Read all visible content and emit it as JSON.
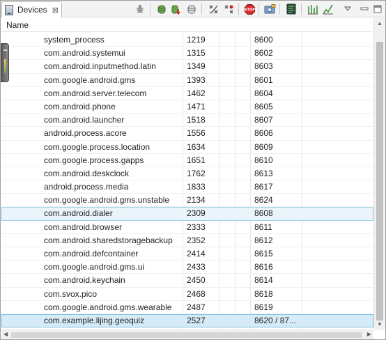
{
  "tab": {
    "label": "Devices",
    "close": "⊠"
  },
  "toolbar": {
    "icons": [
      "bug-icon",
      "heap-icon",
      "heap-dump-icon",
      "gc-icon",
      "threads-icon",
      "method-profiling-icon",
      "stop-process-icon",
      "screen-capture-icon",
      "systrace-icon",
      "allocation-tracker-icon",
      "network-icon",
      "view-menu-icon"
    ]
  },
  "table": {
    "columns": {
      "name": "Name"
    },
    "rows": [
      {
        "name": "system_process",
        "pid": "1219",
        "port": "8600"
      },
      {
        "name": "com.android.systemui",
        "pid": "1315",
        "port": "8602"
      },
      {
        "name": "com.android.inputmethod.latin",
        "pid": "1349",
        "port": "8603"
      },
      {
        "name": "com.google.android.gms",
        "pid": "1393",
        "port": "8601"
      },
      {
        "name": "com.android.server.telecom",
        "pid": "1462",
        "port": "8604"
      },
      {
        "name": "com.android.phone",
        "pid": "1471",
        "port": "8605"
      },
      {
        "name": "com.android.launcher",
        "pid": "1518",
        "port": "8607"
      },
      {
        "name": "android.process.acore",
        "pid": "1556",
        "port": "8606"
      },
      {
        "name": "com.google.process.location",
        "pid": "1634",
        "port": "8609"
      },
      {
        "name": "com.google.process.gapps",
        "pid": "1651",
        "port": "8610"
      },
      {
        "name": "com.android.deskclock",
        "pid": "1762",
        "port": "8613"
      },
      {
        "name": "android.process.media",
        "pid": "1833",
        "port": "8617"
      },
      {
        "name": "com.google.android.gms.unstable",
        "pid": "2134",
        "port": "8624"
      },
      {
        "name": "com.android.dialer",
        "pid": "2309",
        "port": "8608"
      },
      {
        "name": "com.android.browser",
        "pid": "2333",
        "port": "8611"
      },
      {
        "name": "com.android.sharedstoragebackup",
        "pid": "2352",
        "port": "8612"
      },
      {
        "name": "com.android.defcontainer",
        "pid": "2414",
        "port": "8615"
      },
      {
        "name": "com.google.android.gms.ui",
        "pid": "2433",
        "port": "8616"
      },
      {
        "name": "com.android.keychain",
        "pid": "2450",
        "port": "8614"
      },
      {
        "name": "com.svox.pico",
        "pid": "2468",
        "port": "8618"
      },
      {
        "name": "com.google.android.gms.wearable",
        "pid": "2487",
        "port": "8619"
      },
      {
        "name": "com.example.lijing.geoquiz",
        "pid": "2527",
        "port": "8620 / 87..."
      }
    ]
  },
  "colors": {
    "selected_light": "#eaf5fb",
    "selected": "#d5ebf8"
  }
}
